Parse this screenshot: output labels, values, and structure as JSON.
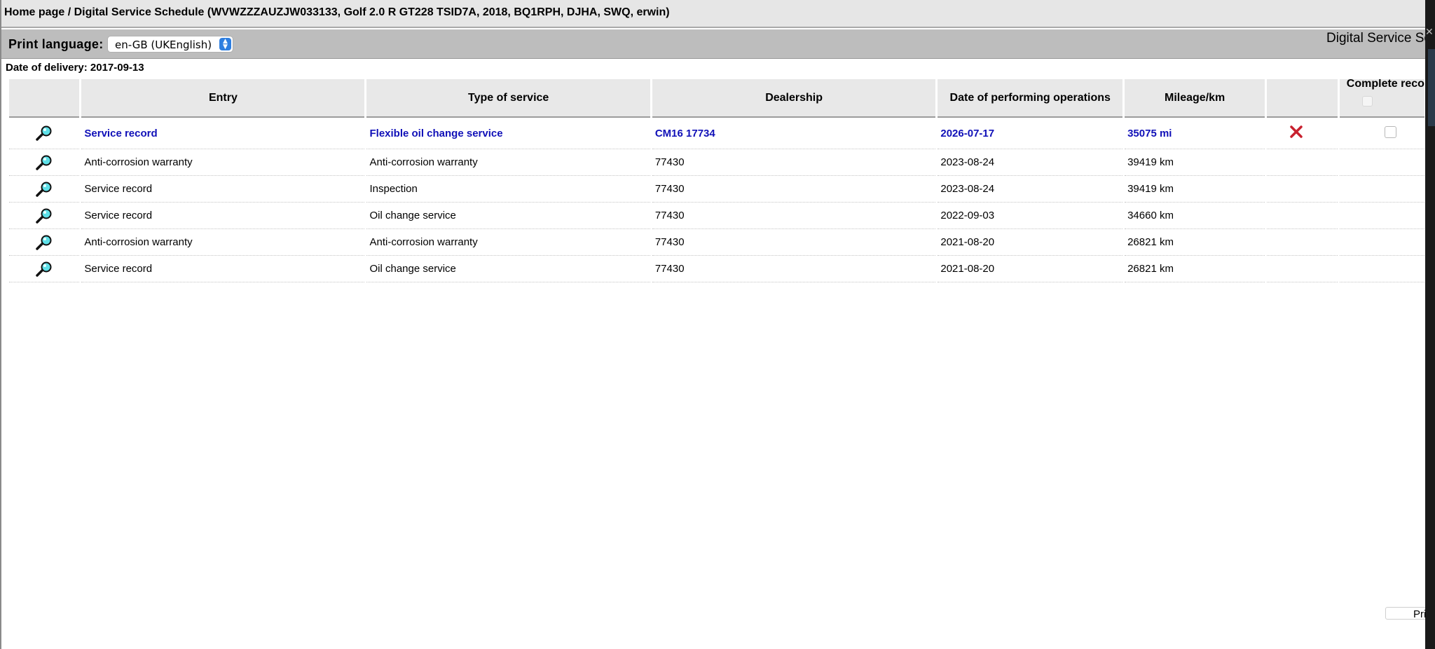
{
  "breadcrumb": "Home page / Digital Service Schedule (WVWZZZAUZJW033133, Golf 2.0 R GT228 TSID7A, 2018, BQ1RPH, DJHA, SWQ, erwin)",
  "app_title": "Digital Service Sc",
  "print_language": {
    "label": "Print language:",
    "selected": "en-GB (UKEnglish)"
  },
  "delivery": {
    "label": "Date of delivery:",
    "value": "2017-09-13"
  },
  "table": {
    "headers": {
      "entry": "Entry",
      "type": "Type of service",
      "dealership": "Dealership",
      "date": "Date of performing operations",
      "mileage": "Mileage/km",
      "complete": "Complete reco"
    },
    "rows": [
      {
        "entry": "Service record",
        "type": "Flexible oil change service",
        "dealership": "CM16 17734",
        "date": "2026-07-17",
        "mileage": "35075 mi"
      },
      {
        "entry": "Anti-corrosion warranty",
        "type": "Anti-corrosion warranty",
        "dealership": "77430",
        "date": "2023-08-24",
        "mileage": "39419 km"
      },
      {
        "entry": "Service record",
        "type": "Inspection",
        "dealership": "77430",
        "date": "2023-08-24",
        "mileage": "39419 km"
      },
      {
        "entry": "Service record",
        "type": "Oil change service",
        "dealership": "77430",
        "date": "2022-09-03",
        "mileage": "34660 km"
      },
      {
        "entry": "Anti-corrosion warranty",
        "type": "Anti-corrosion warranty",
        "dealership": "77430",
        "date": "2021-08-20",
        "mileage": "26821 km"
      },
      {
        "entry": "Service record",
        "type": "Oil change service",
        "dealership": "77430",
        "date": "2021-08-20",
        "mileage": "26821 km"
      }
    ]
  },
  "print_button": "Pri",
  "colors": {
    "highlight_text": "#1010b8",
    "delete_icon": "#c8202e",
    "magnifier_lens": "#5ee0e8"
  },
  "icons": {
    "view": "magnifier-icon",
    "delete": "delete-x-icon",
    "close": "close-icon"
  }
}
